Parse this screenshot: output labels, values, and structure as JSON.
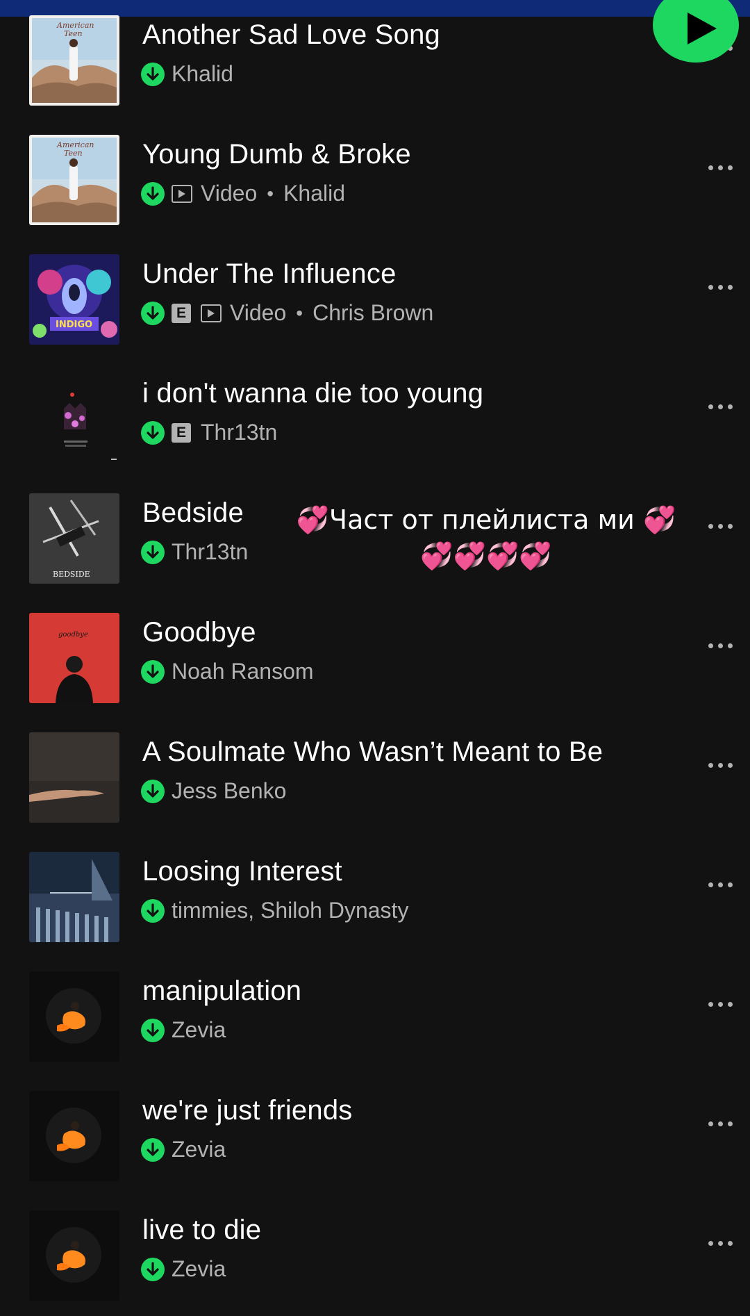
{
  "header": {
    "play_icon": "play-icon",
    "accent": "#1ed760",
    "bar_color": "#0f2a76"
  },
  "tracks": [
    {
      "title": "Another Sad Love Song",
      "artist": "Khalid",
      "video": "",
      "explicit": "",
      "cover": "american-teen"
    },
    {
      "title": "Young Dumb & Broke",
      "artist": "Khalid",
      "video": "Video",
      "explicit": "",
      "cover": "american-teen"
    },
    {
      "title": "Under The Influence",
      "artist": "Chris Brown",
      "video": "Video",
      "explicit": "E",
      "cover": "indigo"
    },
    {
      "title": "i don't wanna die too young",
      "artist": "Thr13tn",
      "video": "",
      "explicit": "E",
      "cover": "dark-castle"
    },
    {
      "title": "Bedside",
      "artist": "Thr13tn",
      "video": "",
      "explicit": "",
      "cover": "bedside"
    },
    {
      "title": "Goodbye",
      "artist": "Noah Ransom",
      "video": "",
      "explicit": "",
      "cover": "goodbye-red"
    },
    {
      "title": "A Soulmate Who Wasn’t Meant to Be",
      "artist": "Jess Benko",
      "video": "",
      "explicit": "",
      "cover": "hand"
    },
    {
      "title": "Loosing Interest",
      "artist": "timmies, Shiloh Dynasty",
      "video": "",
      "explicit": "",
      "cover": "blue-room"
    },
    {
      "title": "manipulation",
      "artist": "Zevia",
      "video": "",
      "explicit": "",
      "cover": "zevia"
    },
    {
      "title": "we're just friends",
      "artist": "Zevia",
      "video": "",
      "explicit": "",
      "cover": "zevia"
    },
    {
      "title": "live to die",
      "artist": "Zevia",
      "video": "",
      "explicit": "",
      "cover": "zevia"
    }
  ],
  "overlay": {
    "line1_text": "Част от плейлиста ми",
    "heart_emoji": "💞",
    "line2_hearts": "💞💞💞💞"
  }
}
